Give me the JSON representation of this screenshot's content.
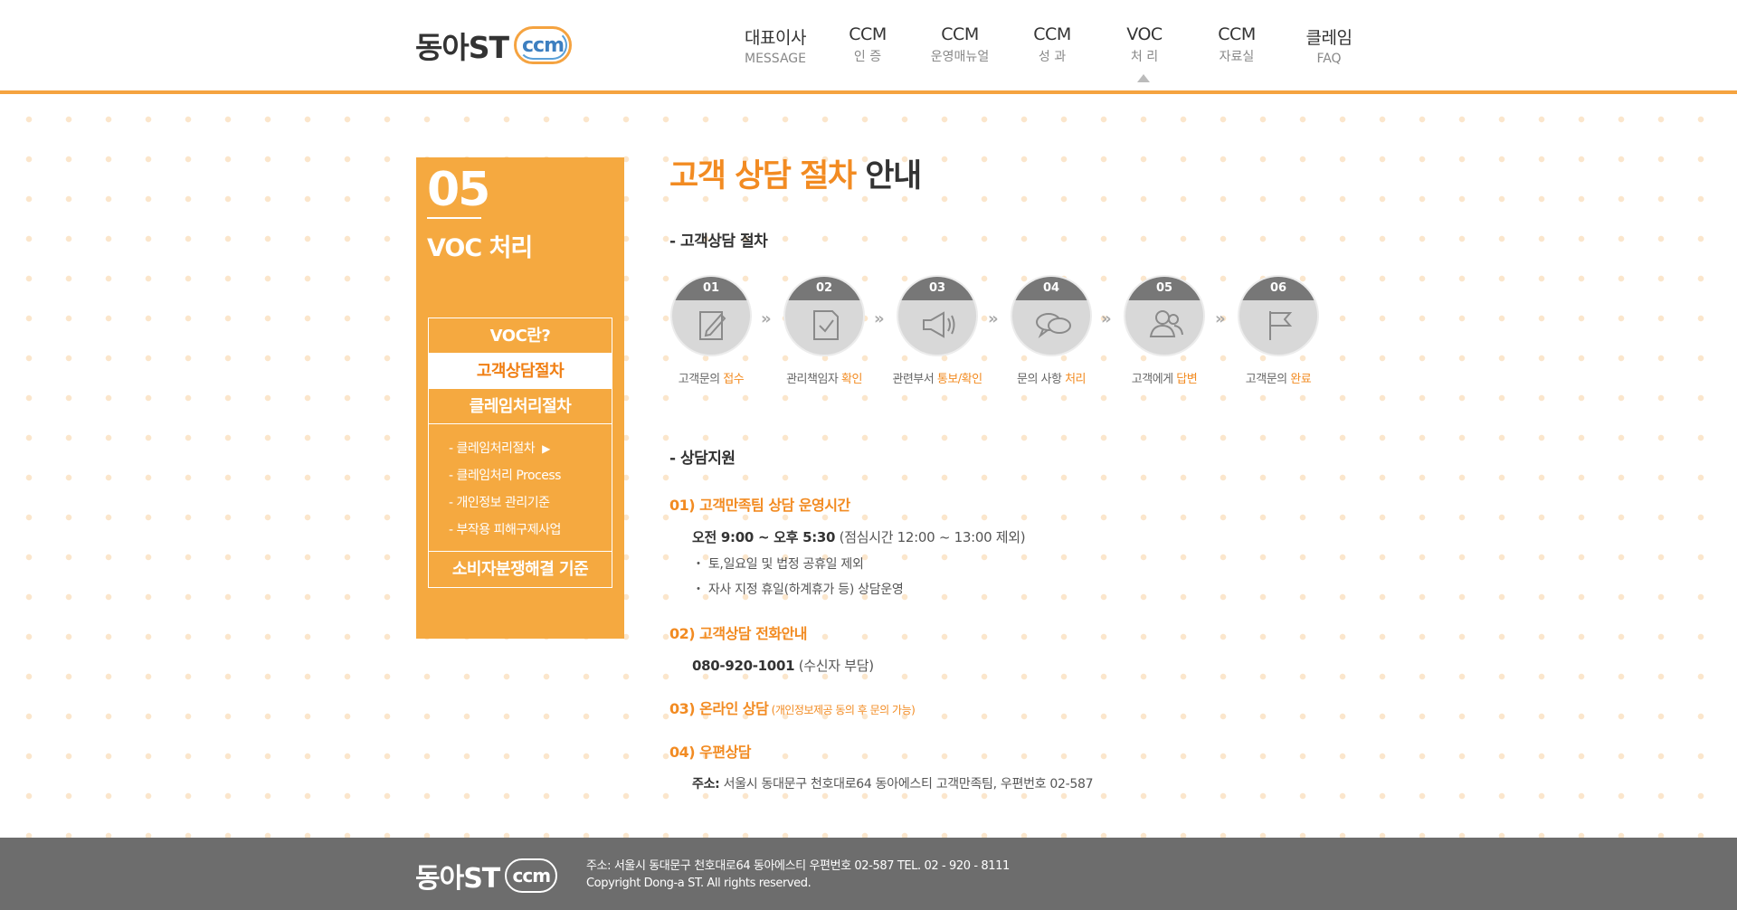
{
  "header": {
    "logo_text": "동아ST",
    "logo_badge": "ccm",
    "nav": [
      {
        "main": "대표이사",
        "sub": "MESSAGE"
      },
      {
        "main": "CCM",
        "sub": "인 증"
      },
      {
        "main": "CCM",
        "sub": "운영매뉴얼"
      },
      {
        "main": "CCM",
        "sub": "성 과"
      },
      {
        "main": "VOC",
        "sub": "처 리"
      },
      {
        "main": "CCM",
        "sub": "자료실"
      },
      {
        "main": "클레임",
        "sub": "FAQ"
      }
    ]
  },
  "sidebar": {
    "number": "05",
    "title": "VOC 처리",
    "items": [
      {
        "label": "VOC란?"
      },
      {
        "label": "고객상담절차"
      },
      {
        "label": "클레임처리절차"
      }
    ],
    "sub_items": [
      {
        "label": "- 클레임처리절차",
        "marker": "▶"
      },
      {
        "label": "- 클레임처리 Process"
      },
      {
        "label": "- 개인정보 관리기준"
      },
      {
        "label": "- 부작용 피해구제사업"
      }
    ],
    "last_item": "소비자분쟁해결 기준"
  },
  "main": {
    "title_orange": "고객 상담 절차",
    "title_dark": " 안내",
    "process_heading": "- 고객상담 절차",
    "steps": [
      {
        "num": "01",
        "icon": "edit-icon",
        "text": "고객문의 ",
        "highlight": "접수"
      },
      {
        "num": "02",
        "icon": "check-document-icon",
        "text": "관리책임자 ",
        "highlight": "확인"
      },
      {
        "num": "03",
        "icon": "megaphone-icon",
        "text": "관련부서 ",
        "highlight": "통보/확인"
      },
      {
        "num": "04",
        "icon": "chat-bubbles-icon",
        "text": "문의 사항 ",
        "highlight": "처리"
      },
      {
        "num": "05",
        "icon": "users-icon",
        "text": "고객에게 ",
        "highlight": "답변"
      },
      {
        "num": "06",
        "icon": "flag-icon",
        "text": "고객문의 ",
        "highlight": "완료"
      }
    ],
    "chevron": "»",
    "support_heading": "- 상담지원",
    "hours": {
      "head": "01) 고객만족팀  상담 운영시간",
      "time_bold": "오전 9:00 ~ 오후 5:30",
      "time_note": " (점심시간 12:00 ~ 13:00 제외)",
      "note1": "・ 토,일요일 및 법정 공휴일 제외",
      "note2": "・ 자사 지정 휴일(하계휴가 등) 상담운영"
    },
    "phone": {
      "head": "02) 고객상담 전화안내",
      "number": "080-920-1001",
      "note": " (수신자 부담)"
    },
    "online": {
      "head": "03) 온라인 상담",
      "note": " (개인정보제공 동의 후 문의 가능)"
    },
    "mail": {
      "head": "04) 우편상담",
      "label": "주소:",
      "address": " 서울시 동대문구 천호대로64  동아에스티 고객만족팀, 우편번호 02-587"
    }
  },
  "footer": {
    "logo_text": "동아ST",
    "logo_badge": "ccm",
    "address": "주소: 서울시 동대문구 천호대로64  동아에스티 우편번호 02-587 TEL. 02 - 920 - 8111",
    "copyright": "Copyright Dong-a ST. All rights reserved."
  },
  "colors": {
    "accent": "#f28b22",
    "sidebar": "#f5a940",
    "footer": "#6d6d6d",
    "step_circle": "#d8d8d8"
  }
}
